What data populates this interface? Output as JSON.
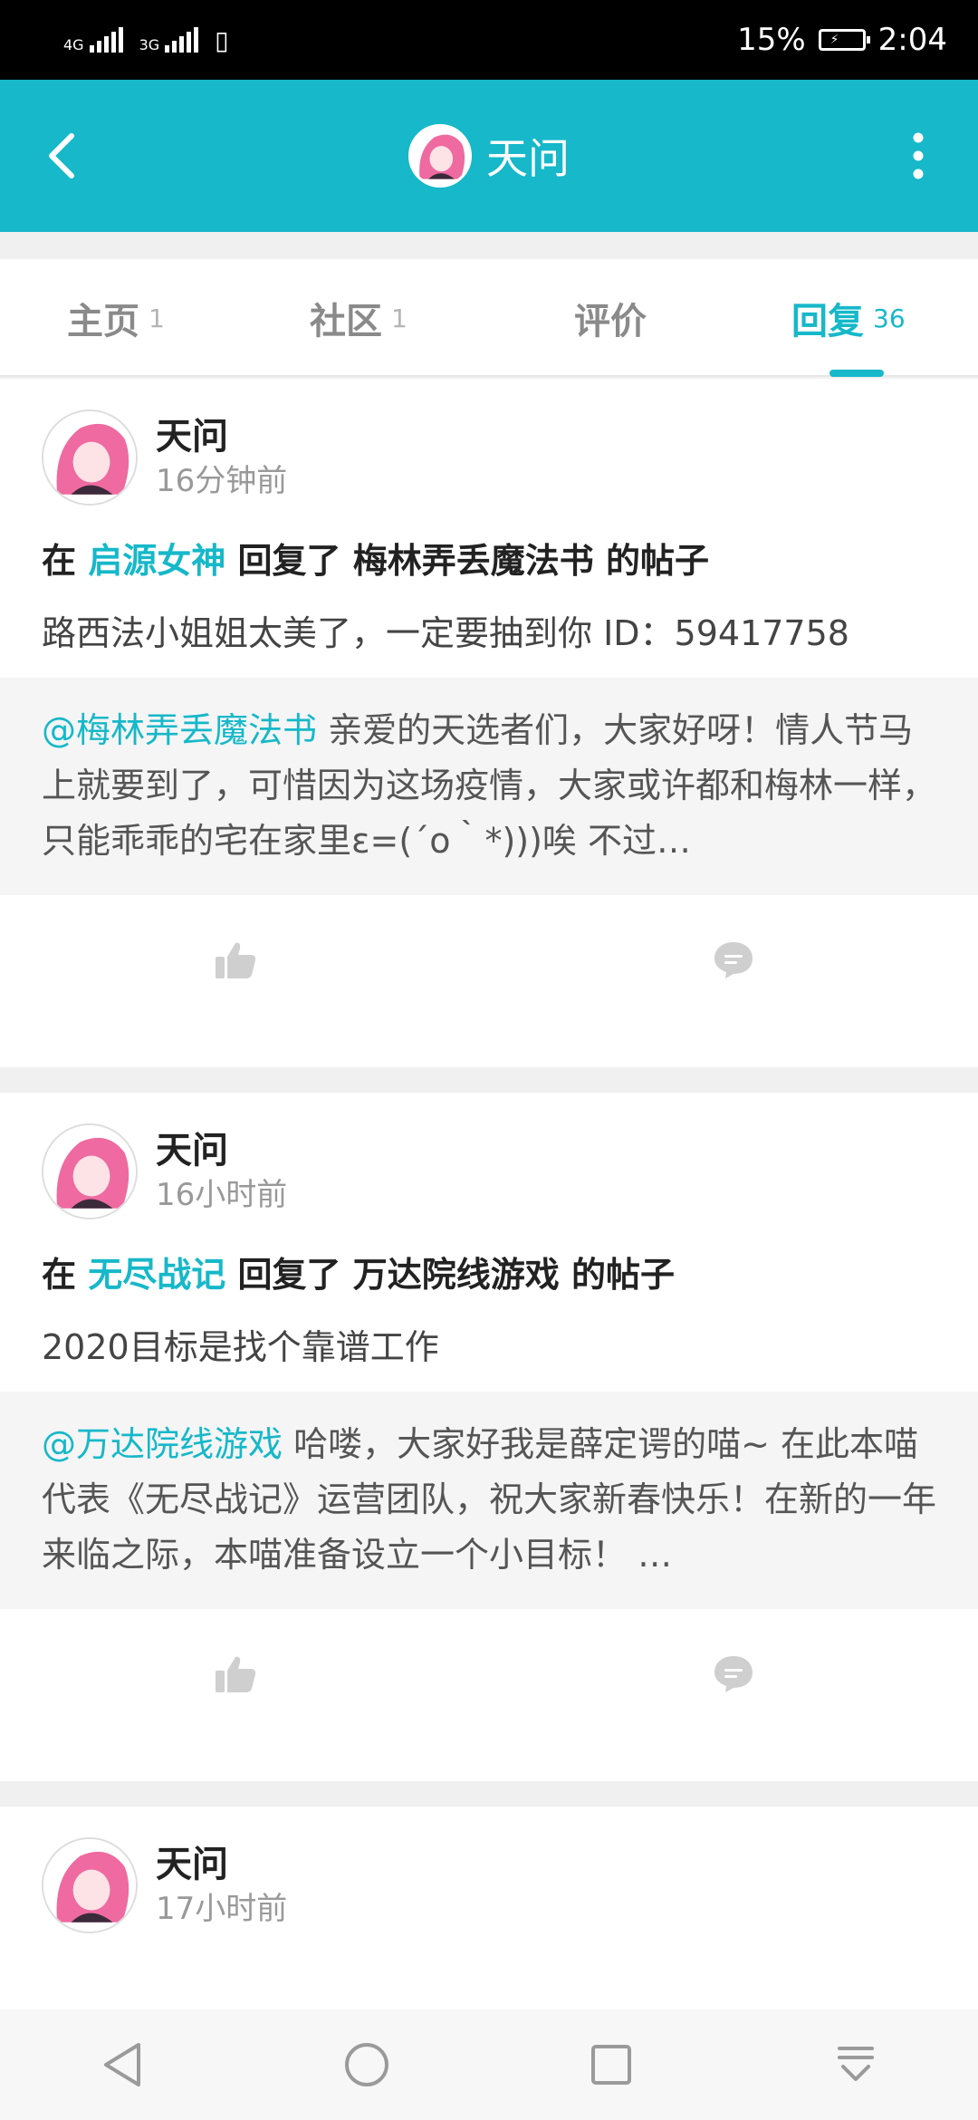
{
  "status_bar": {
    "signal1_tag": "4G",
    "signal2_tag": "3G",
    "battery": "15%",
    "time": "2:04"
  },
  "header": {
    "title": "天问"
  },
  "tabs": [
    {
      "label": "主页",
      "count": "1"
    },
    {
      "label": "社区",
      "count": "1"
    },
    {
      "label": "评价",
      "count": ""
    },
    {
      "label": "回复",
      "count": "36"
    }
  ],
  "posts": [
    {
      "username": "天问",
      "time": "16分钟前",
      "action_prefix": "在",
      "community": "启源女神",
      "action_middle": "回复了",
      "target_author": "梅林弄丢魔法书",
      "action_suffix": "的帖子",
      "reply": "路西法小姐姐太美了，一定要抽到你 ID：59417758",
      "quote_at": "@梅林弄丢魔法书",
      "quote_text": " 亲爱的天选者们，大家好呀！情人节马上就要到了，可惜因为这场疫情，大家或许都和梅林一样，只能乖乖的宅在家里ε=(´ο｀*)))唉 不过…"
    },
    {
      "username": "天问",
      "time": "16小时前",
      "action_prefix": "在",
      "community": "无尽战记",
      "action_middle": "回复了",
      "target_author": "万达院线游戏",
      "action_suffix": "的帖子",
      "reply": "2020目标是找个靠谱工作",
      "quote_at": "@万达院线游戏",
      "quote_text": " 哈喽，大家好我是薛定谔的喵~ 在此本喵代表《无尽战记》运营团队，祝大家新春快乐！在新的一年来临之际，本喵准备设立一个小目标！ …"
    },
    {
      "username": "天问",
      "time": "17小时前"
    }
  ],
  "colors": {
    "accent": "#16b8c9",
    "topbar": "#16b8c9",
    "quote_bg": "#f5f5f5"
  },
  "icons": {
    "back": "back-arrow-icon",
    "more": "more-vertical-icon",
    "like": "thumbs-up-icon",
    "comment": "comment-bubble-icon"
  }
}
